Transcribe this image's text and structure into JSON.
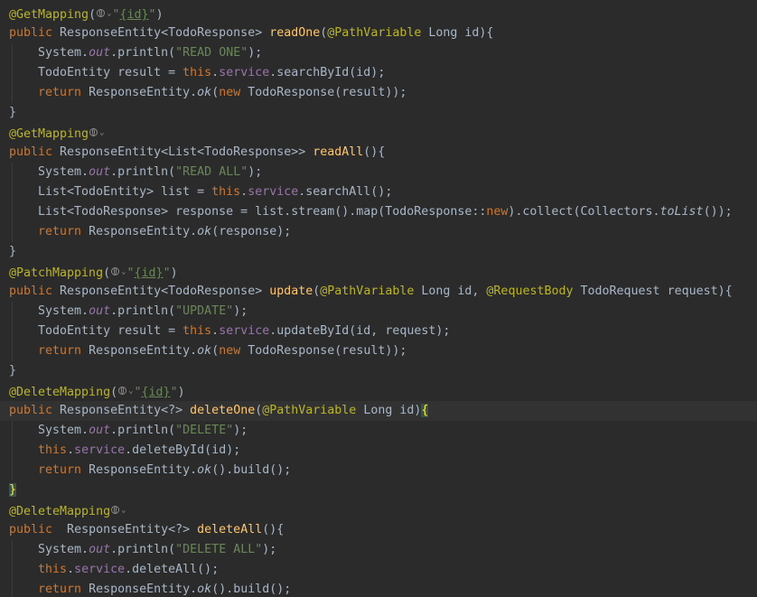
{
  "colors": {
    "background": "#2b2b2b",
    "current_line": "#323232",
    "annotation": "#bbb529",
    "keyword": "#cc7832",
    "string": "#6a8759",
    "method_decl": "#ffc66d",
    "field": "#9876aa",
    "default_text": "#a9b7c6"
  },
  "code": {
    "get_mapping": "@GetMapping",
    "patch_mapping": "@PatchMapping",
    "delete_mapping": "@DeleteMapping",
    "path_variable": "@PathVariable",
    "request_body": "@RequestBody",
    "id_placeholder": "{id}",
    "public": "public",
    "new": "new",
    "return": "return",
    "this": "this",
    "service": "service",
    "out": "out",
    "ok": "ok",
    "to_list": "toList",
    "read_one": "readOne",
    "read_all": "readAll",
    "update": "update",
    "delete_one": "deleteOne",
    "delete_all": "deleteAll",
    "str_read_one": "\"READ ONE\"",
    "str_read_all": "\"READ ALL\"",
    "str_update": "\"UPDATE\"",
    "str_delete": "\"DELETE\"",
    "str_delete_all": "\"DELETE ALL\"",
    "t_response_entity_todo": " ResponseEntity<TodoResponse> ",
    "t_response_entity_list": " ResponseEntity<List<TodoResponse>> ",
    "t_response_entity_wild": " ResponseEntity<?> ",
    "t_response_entity_wild2": "  ResponseEntity<?> ",
    "t_long_id": " Long id",
    "t_long_id_comma": " Long id, ",
    "t_todo_request": " TodoRequest request){",
    "system": "    System.",
    "println": ".println(",
    "close_semi": ");",
    "close_brace": "}",
    "indent": "    ",
    "todo_entity_result": "    TodoEntity result = ",
    "search_by_id": ".searchById(id);",
    "update_by_id": ".updateById(id, request);",
    "response_entity_dot": " ResponseEntity.",
    "new_todo_response_result": "(new TodoResponse(result));",
    "list_todo_entity": "    List<TodoEntity> list = ",
    "search_all": ".searchAll();",
    "list_todo_response": "    List<TodoResponse> response = list.stream().map(TodoResponse::",
    "collect": ").collect(Collectors.",
    "close_double": "());",
    "response_arg": "(response);",
    "delete_by_id": ".deleteById(id);",
    "delete_all_call": ".deleteAll();",
    "build_call": "().build();",
    "open_paren": "(",
    "open_paren_id": "(",
    "close_paren_brace": "(){",
    "id_brace": "){",
    "dot": ".",
    "quote": "\"",
    "close_paren_q": "\")"
  }
}
